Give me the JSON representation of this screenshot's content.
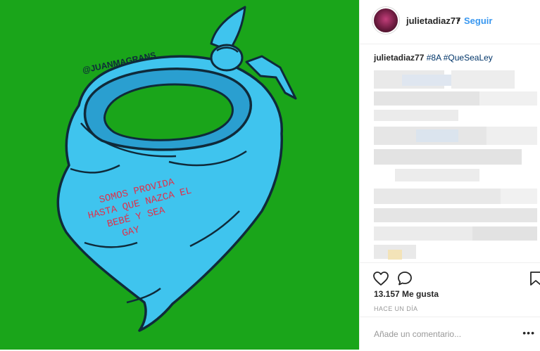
{
  "post": {
    "author": "julietadiaz77",
    "follow_separator": "•",
    "follow_label": "Seguir",
    "caption_user": "julietadiaz77",
    "caption_tags": "#8A #QueSeaLey",
    "likes": "13.157 Me gusta",
    "time_ago": "HACE UN DÍA",
    "comment_placeholder": "Añade un comentario...",
    "more_label": "•••"
  },
  "image": {
    "signature": "@JUANMAGRANS",
    "text_lines": [
      "SOMOS PROVIDA",
      "HASTA QUE NAZCA EL",
      "BEBÉ Y SEA",
      "GAY"
    ],
    "background_color": "#1aa51a",
    "scarf_color": "#3fc4ee",
    "text_color": "#e0304a"
  },
  "icons": {
    "like": "heart-icon",
    "comment": "comment-icon",
    "save": "bookmark-icon"
  }
}
